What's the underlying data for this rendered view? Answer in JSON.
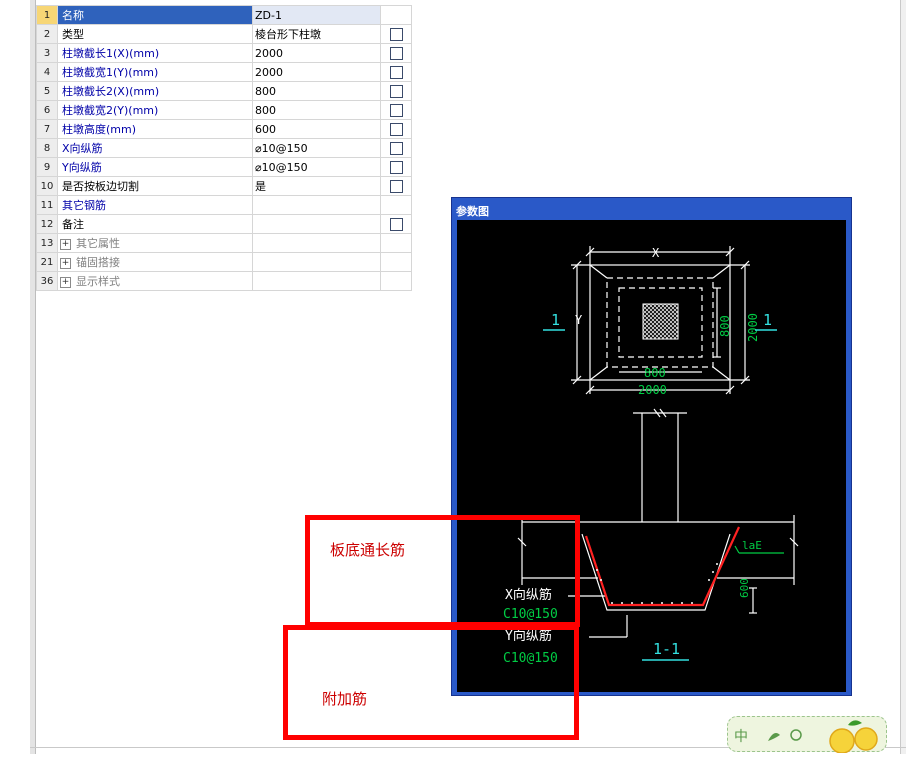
{
  "properties": {
    "rows": [
      {
        "num": "1",
        "name": "名称",
        "value": "ZD-1",
        "checkbox": false,
        "selected": true
      },
      {
        "num": "2",
        "name": "类型",
        "value": "棱台形下柱墩",
        "checkbox": true
      },
      {
        "num": "3",
        "name": "柱墩截长1(X)(mm)",
        "value": "2000",
        "checkbox": true
      },
      {
        "num": "4",
        "name": "柱墩截宽1(Y)(mm)",
        "value": "2000",
        "checkbox": true
      },
      {
        "num": "5",
        "name": "柱墩截长2(X)(mm)",
        "value": "800",
        "checkbox": true
      },
      {
        "num": "6",
        "name": "柱墩截宽2(Y)(mm)",
        "value": "800",
        "checkbox": true
      },
      {
        "num": "7",
        "name": "柱墩高度(mm)",
        "value": "600",
        "checkbox": true
      },
      {
        "num": "8",
        "name": "X向纵筋",
        "value": "⌀10@150",
        "checkbox": true
      },
      {
        "num": "9",
        "name": "Y向纵筋",
        "value": "⌀10@150",
        "checkbox": true
      },
      {
        "num": "10",
        "name": "是否按板边切割",
        "value": "是",
        "checkbox": true
      },
      {
        "num": "11",
        "name": "其它钢筋",
        "value": "",
        "checkbox": false
      },
      {
        "num": "12",
        "name": "备注",
        "value": "",
        "checkbox": true
      },
      {
        "num": "13",
        "name": "其它属性",
        "value": "",
        "checkbox": false,
        "group": true
      },
      {
        "num": "21",
        "name": "锚固搭接",
        "value": "",
        "checkbox": false,
        "group": true
      },
      {
        "num": "36",
        "name": "显示样式",
        "value": "",
        "checkbox": false,
        "group": true
      }
    ]
  },
  "diagram": {
    "title": "参数图",
    "labels": {
      "x": "X",
      "y": "Y",
      "dim_800_v": "800",
      "dim_2000_v": "2000",
      "dim_800_h": "800",
      "dim_2000_h": "2000",
      "section_left": "1",
      "section_right": "1",
      "lae": "laE",
      "dim_600": "600",
      "x_bar_label": "X向纵筋",
      "x_bar_value": "C10@150",
      "y_bar_label": "Y向纵筋",
      "y_bar_value": "C10@150",
      "section_name": "1-1"
    }
  },
  "annotations": {
    "bottom_bar": "板底通长筋",
    "additional_bar": "附加筋"
  },
  "colors": {
    "selected_row": "#2f62bc",
    "panel_title": "#2a59c8",
    "dim_green": "#00cc44",
    "label_cyan": "#33e0e0",
    "annotation_red": "#ff0000"
  }
}
